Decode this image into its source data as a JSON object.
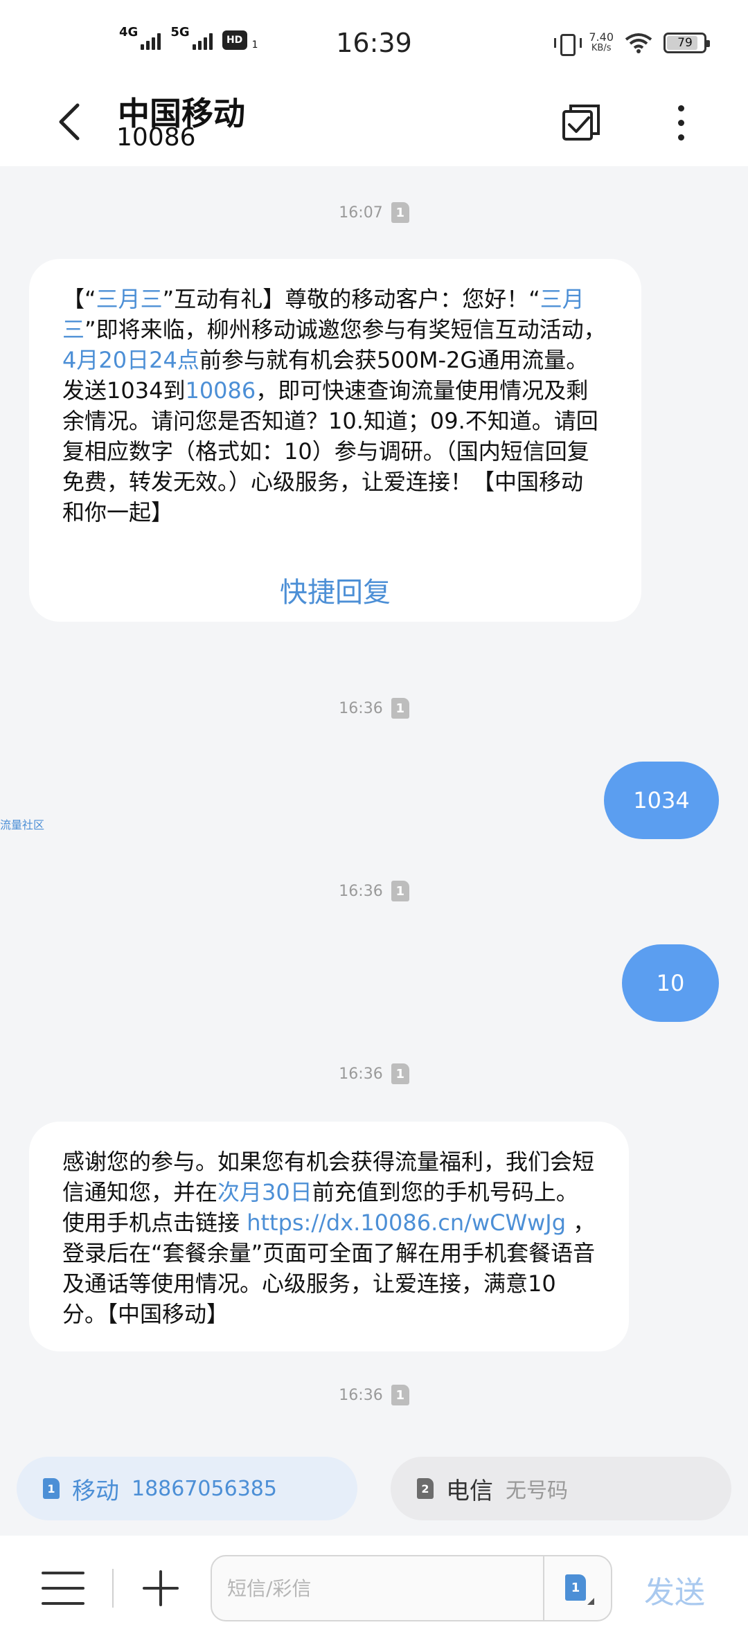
{
  "status_bar": {
    "net1": "4G",
    "net2": "5G",
    "hd": "HD",
    "hd_sub": "1",
    "time": "16:39",
    "speed_value": "7.40",
    "speed_unit": "KB/s",
    "battery": "79"
  },
  "header": {
    "title": "中国移动",
    "number": "10086"
  },
  "messages": {
    "stamp1": "16:07",
    "stamp2": "16:36",
    "stamp3": "16:36",
    "stamp4": "16:36",
    "stamp5": "16:36",
    "sim_tag": "1",
    "msg1_parts": [
      "【“",
      "三月三",
      "”互动有礼】尊敬的移动客户：您好！“",
      "三月三",
      "”即将来临，柳州移动诚邀您参与有奖短信互动活动，",
      "4月20日24点",
      "前参与就有机会获500M-2G通用流量。发送1034到",
      "10086",
      "，即可快速查询流量使用情况及剩余情况。请问您是否知道？10.知道；09.不知道。请回复相应数字（格式如：10）参与调研。（国内短信回复免费，转发无效。）心级服务，让爱连接！【中国移动 和你一起】"
    ],
    "quick_reply": "快捷回复",
    "out1": "1034",
    "out2": "10",
    "side_label": "流量社区",
    "msg2_parts": [
      "感谢您的参与。如果您有机会获得流量福利，我们会短信通知您，并在",
      "次月30日",
      "前充值到您的手机号码上。使用手机点击链接 ",
      "https://dx.10086.cn/wCWwJg",
      " ，登录后在“套餐余量”页面可全面了解在用手机套餐语音及通话等使用情况。心级服务，让爱连接，满意10分。【中国移动】"
    ]
  },
  "sim_select": {
    "sim1_tag": "1",
    "sim1_carrier": "移动",
    "sim1_number": "18867056385",
    "sim2_tag": "2",
    "sim2_carrier": "电信",
    "sim2_number": "无号码"
  },
  "composer": {
    "placeholder": "短信/彩信",
    "sim_tag": "1",
    "send": "发送"
  },
  "colors": {
    "accent": "#4c8fd6",
    "outgoing_bubble": "#5b9ef0",
    "background": "#f4f5f7"
  }
}
